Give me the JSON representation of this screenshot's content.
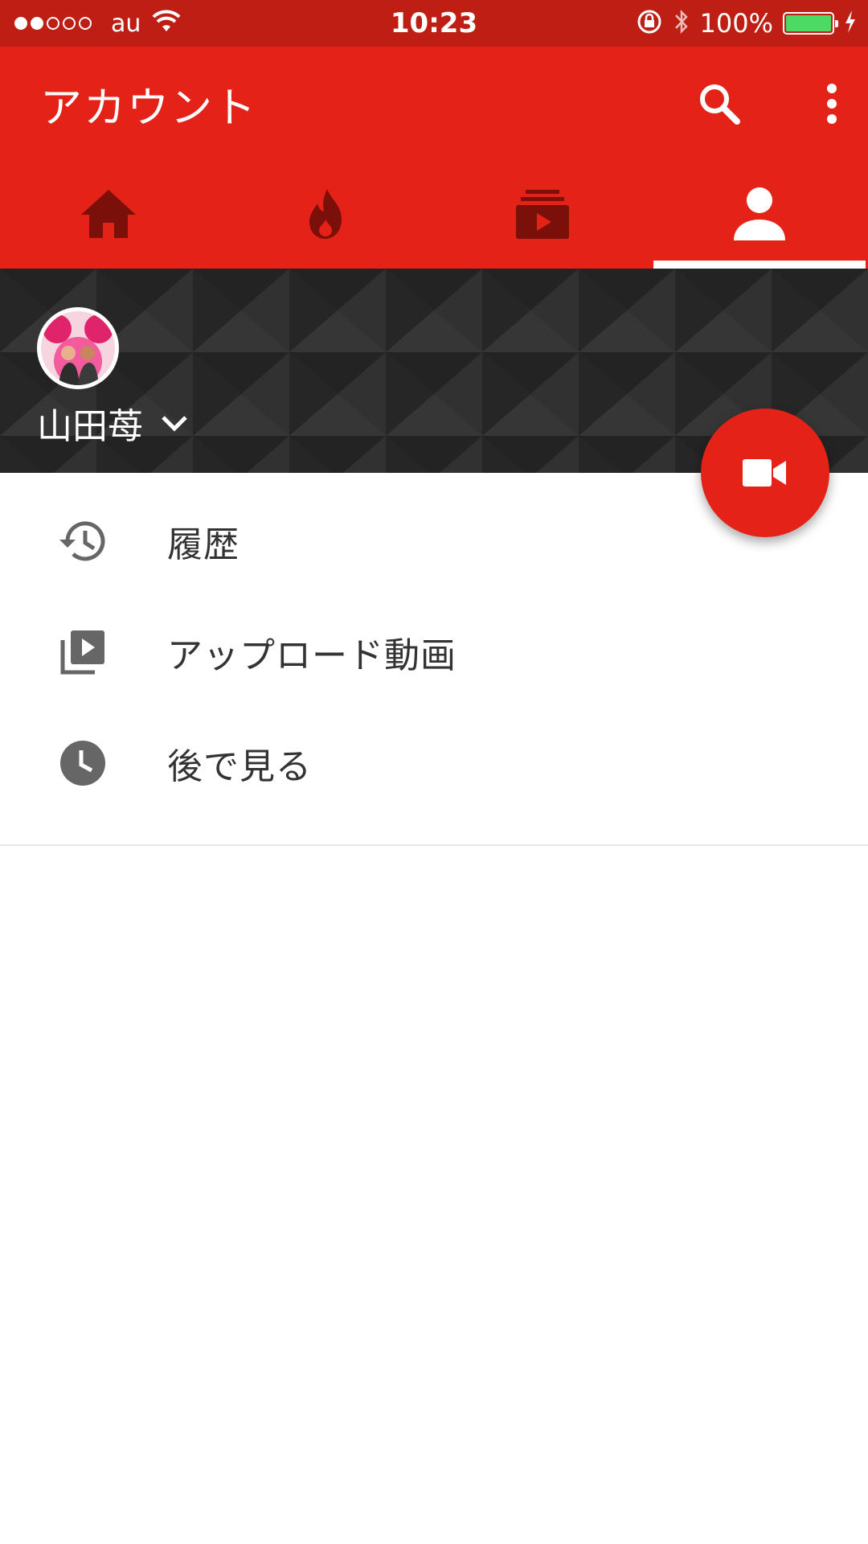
{
  "status_bar": {
    "signal_dots": [
      true,
      true,
      false,
      false,
      false
    ],
    "carrier": "au",
    "time": "10:23",
    "battery_percent": "100%",
    "icons": [
      "wifi-icon",
      "rotation-lock-icon",
      "bluetooth-icon",
      "battery-icon",
      "charging-icon"
    ]
  },
  "app_bar": {
    "title": "アカウント",
    "actions": [
      "search-icon",
      "more-vertical-icon"
    ],
    "tabs": [
      {
        "name": "home",
        "icon": "home-icon",
        "active": false
      },
      {
        "name": "trending",
        "icon": "flame-icon",
        "active": false
      },
      {
        "name": "subscriptions",
        "icon": "subscriptions-icon",
        "active": false
      },
      {
        "name": "account",
        "icon": "person-icon",
        "active": true
      }
    ],
    "color": "#e52217"
  },
  "channel": {
    "name": "山田苺",
    "dropdown_icon": "chevron-down-icon"
  },
  "fab": {
    "icon": "video-camera-icon",
    "color": "#e52217"
  },
  "menu": {
    "items": [
      {
        "label": "履歴",
        "icon": "history-icon"
      },
      {
        "label": "アップロード動画",
        "icon": "video-library-icon"
      },
      {
        "label": "後で見る",
        "icon": "clock-icon"
      }
    ]
  }
}
